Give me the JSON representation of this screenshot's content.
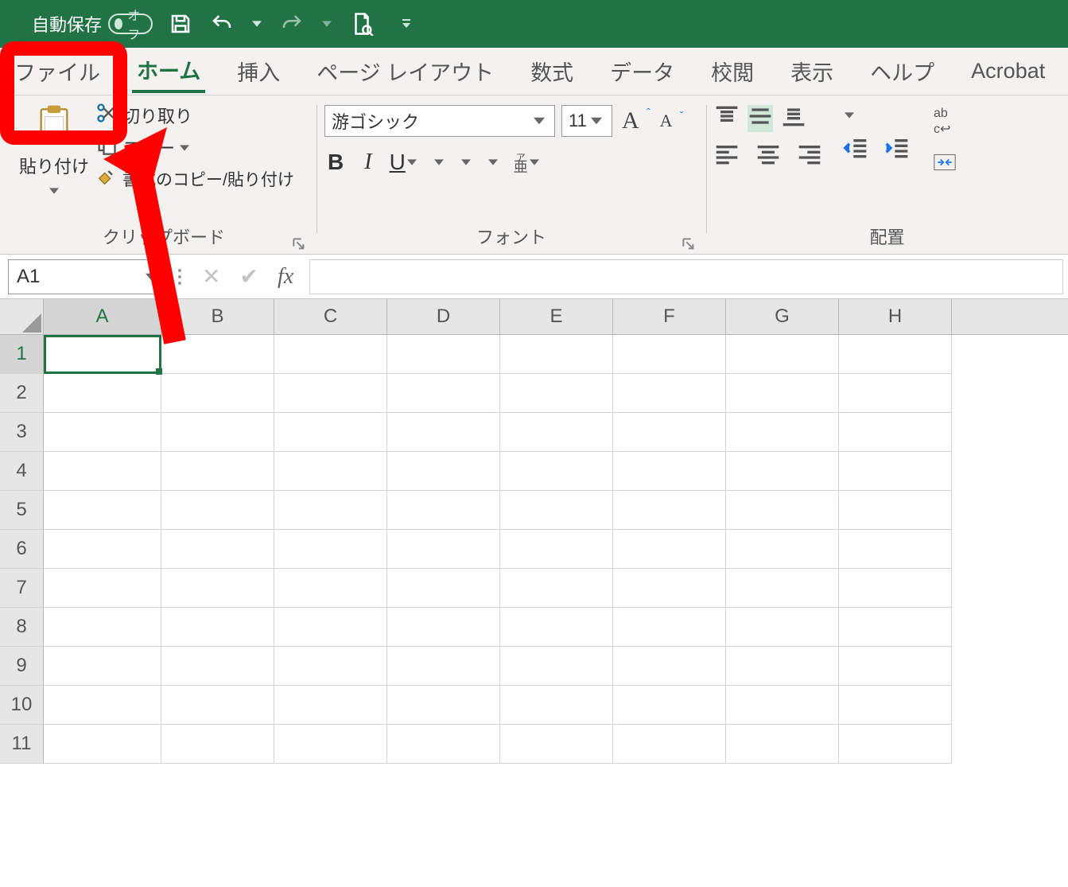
{
  "titlebar": {
    "autosave_label": "自動保存",
    "autosave_state": "オフ"
  },
  "tabs": [
    {
      "id": "file",
      "label": "ファイル"
    },
    {
      "id": "home",
      "label": "ホーム",
      "active": true
    },
    {
      "id": "insert",
      "label": "挿入"
    },
    {
      "id": "layout",
      "label": "ページ レイアウト"
    },
    {
      "id": "formulas",
      "label": "数式"
    },
    {
      "id": "data",
      "label": "データ"
    },
    {
      "id": "review",
      "label": "校閲"
    },
    {
      "id": "view",
      "label": "表示"
    },
    {
      "id": "help",
      "label": "ヘルプ"
    },
    {
      "id": "acrobat",
      "label": "Acrobat"
    }
  ],
  "ribbon": {
    "clipboard": {
      "paste": "貼り付け",
      "cut": "切り取り",
      "copy": "コピー",
      "format_painter": "書式のコピー/貼り付け",
      "group_label": "クリップボード"
    },
    "font": {
      "font_name": "游ゴシック",
      "font_size": "11",
      "bold": "B",
      "italic": "I",
      "underline": "U",
      "phonetic": "ア亜",
      "group_label": "フォント"
    },
    "align": {
      "orientation_hint": "ab",
      "wrap_hint": "ab折",
      "group_label": "配置"
    }
  },
  "formula_bar": {
    "name_box": "A1",
    "fx_label": "fx",
    "formula_value": ""
  },
  "grid": {
    "columns": [
      "A",
      "B",
      "C",
      "D",
      "E",
      "F",
      "G",
      "H"
    ],
    "rows": [
      "1",
      "2",
      "3",
      "4",
      "5",
      "6",
      "7",
      "8",
      "9",
      "10",
      "11"
    ],
    "active_cell": {
      "col": "A",
      "row": "1",
      "value": ""
    }
  },
  "annotation": {
    "arrow_points_to": "ファイル tab"
  }
}
